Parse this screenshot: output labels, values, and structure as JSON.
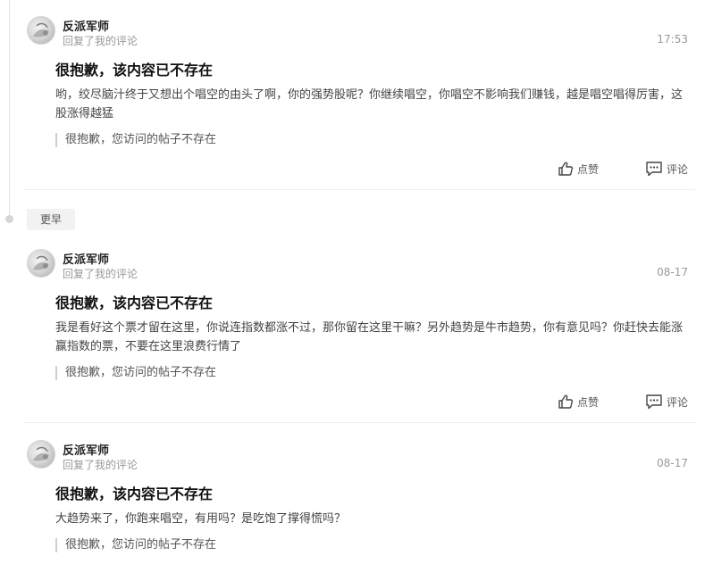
{
  "feed": {
    "earlier_label": "更早",
    "items": [
      {
        "user_name": "反派军师",
        "action": "回复了我的评论",
        "time": "17:53",
        "title": "很抱歉，该内容已不存在",
        "content": "哟，绞尽脑汁终于又想出个唱空的由头了啊，你的强势股呢？你继续唱空，你唱空不影响我们赚钱，越是唱空唱得厉害，这股涨得越猛",
        "quote": "很抱歉，您访问的帖子不存在",
        "like_label": "点赞",
        "comment_label": "评论"
      },
      {
        "user_name": "反派军师",
        "action": "回复了我的评论",
        "time": "08-17",
        "title": "很抱歉，该内容已不存在",
        "content": "我是看好这个票才留在这里，你说连指数都涨不过，那你留在这里干嘛？另外趋势是牛市趋势，你有意见吗？你赶快去能涨赢指数的票，不要在这里浪费行情了",
        "quote": "很抱歉，您访问的帖子不存在",
        "like_label": "点赞",
        "comment_label": "评论"
      },
      {
        "user_name": "反派军师",
        "action": "回复了我的评论",
        "time": "08-17",
        "title": "很抱歉，该内容已不存在",
        "content": "大趋势来了，你跑来唱空，有用吗？是吃饱了撑得慌吗？",
        "quote": "很抱歉，您访问的帖子不存在"
      }
    ]
  },
  "icons": {
    "like": "thumbs-up-icon",
    "comment": "comment-icon",
    "avatar": "avatar-image"
  }
}
